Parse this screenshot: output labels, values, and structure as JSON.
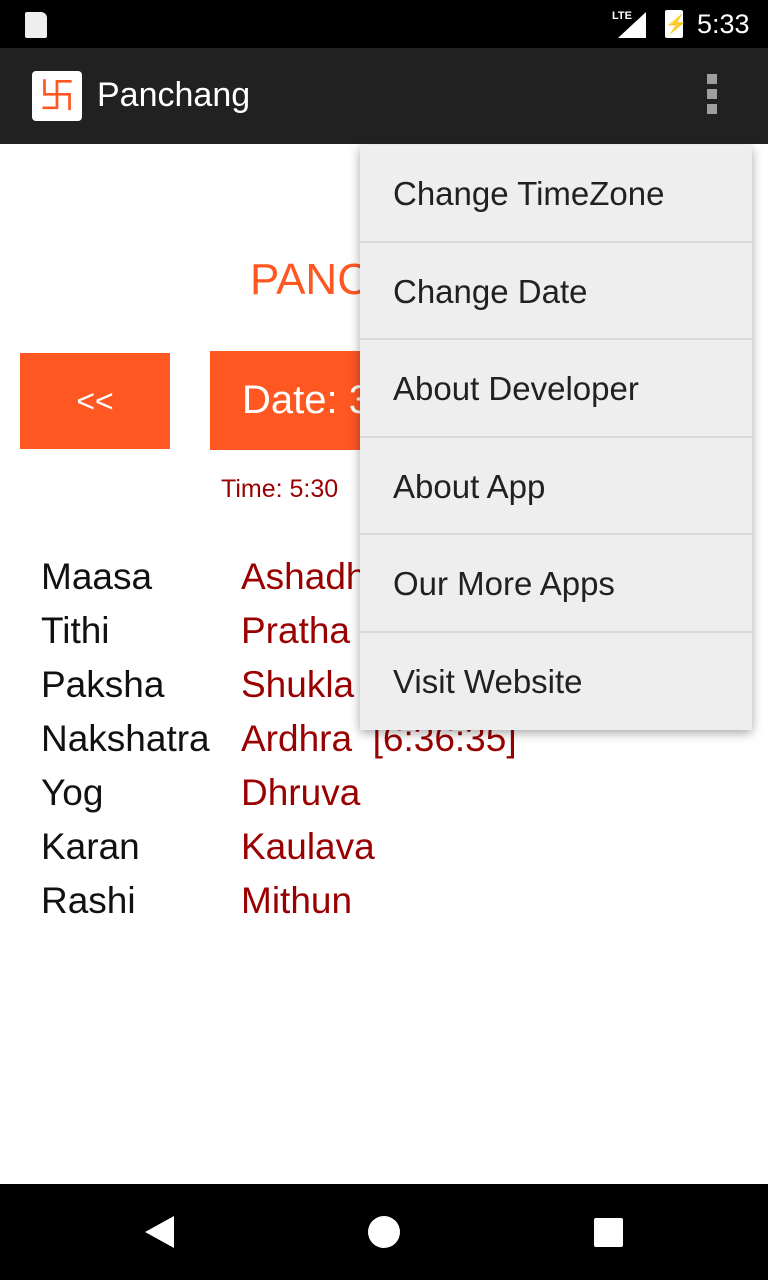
{
  "status_bar": {
    "time": "5:33",
    "network": "LTE",
    "icons": [
      "sd-card-icon",
      "signal-icon",
      "battery-charging-icon"
    ]
  },
  "app_bar": {
    "title": "Panchang",
    "logo_icon": "swastik-icon",
    "menu_icon": "more-vert-icon"
  },
  "main": {
    "heading": "PANC",
    "prev_button": "<<",
    "date_button": "Date: 3",
    "time": "Time: 5:30",
    "rows": [
      {
        "label": "Maasa",
        "value": "Ashadh"
      },
      {
        "label": "Tithi",
        "value": "Pratha"
      },
      {
        "label": "Paksha",
        "value": "Shukla"
      },
      {
        "label": "Nakshatra",
        "value": "Ardhra  [6:36:35]"
      },
      {
        "label": "Yog",
        "value": "Dhruva"
      },
      {
        "label": "Karan",
        "value": "Kaulava"
      },
      {
        "label": "Rashi",
        "value": "Mithun"
      }
    ]
  },
  "overflow_menu": {
    "items": [
      "Change TimeZone",
      "Change Date",
      "About Developer",
      "About App",
      "Our More Apps",
      "Visit Website"
    ]
  },
  "colors": {
    "accent": "#ff5722",
    "value_text": "#990000",
    "app_bar": "#212121",
    "menu_bg": "#eeeeee"
  }
}
